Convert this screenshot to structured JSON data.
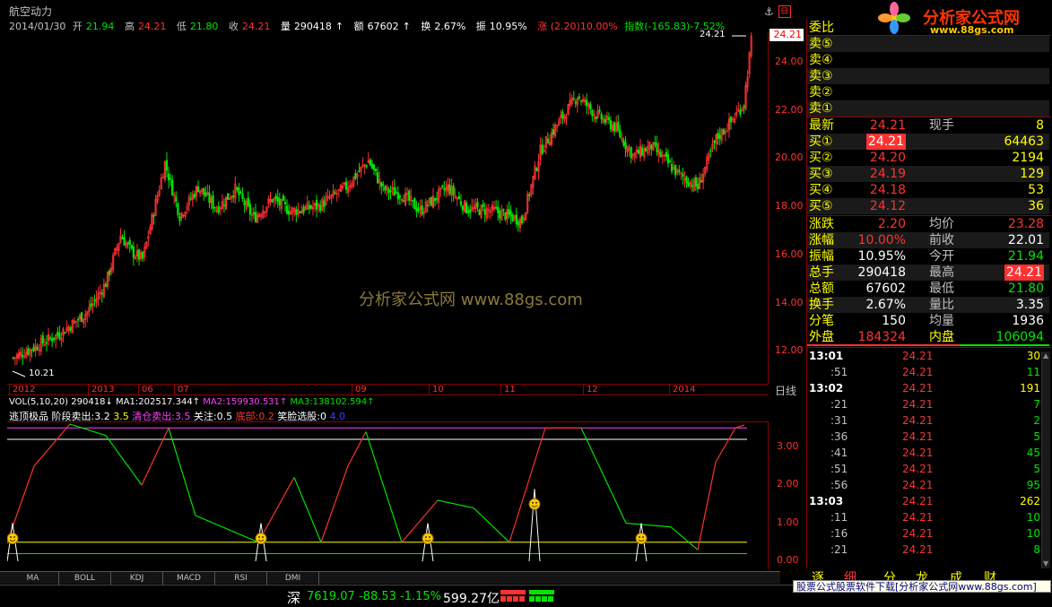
{
  "header": {
    "stock_name": "航空动力",
    "date": "2014/01/30",
    "open_label": "开",
    "open": "21.94",
    "high_label": "高",
    "high": "24.21",
    "low_label": "低",
    "low": "21.80",
    "close_label": "收",
    "close": "24.21",
    "vol_label": "量",
    "vol": "290418",
    "amt_label": "额",
    "amt": "67602",
    "turn_label": "换",
    "turn": "2.67%",
    "amp_label": "振",
    "amp": "10.95%",
    "chg": "涨 (2.20)10.00%",
    "index": "指数(-165.83)-7.52%"
  },
  "price_axis": [
    "24.00",
    "22.00",
    "20.00",
    "18.00",
    "16.00",
    "14.00",
    "12.00"
  ],
  "price_tag": "24.21",
  "max_label": "24.21",
  "min_label": "10.21",
  "watermark": "分析家公式网  www.88gs.com",
  "time_axis": [
    "2012",
    "2013",
    "06",
    "07",
    "09",
    "10",
    "11",
    "12",
    "2014"
  ],
  "period_label": "日线",
  "vol_line": {
    "label": "VOL(5,10,20)",
    "v": "290418",
    "ma1": "MA1:202517.344",
    "ma2": "MA2:159930.531",
    "ma3": "MA3:138102.594"
  },
  "ind_line": {
    "name": "逃顶极品",
    "stage_sell": "阶段卖出:3.2",
    "val35": "3.5",
    "clear_sell": "清仓卖出:3.5",
    "focus": "关注:0.5",
    "bottom": "底部:0.2",
    "laugh": "笑脸选股:0",
    "zero": "4.0"
  },
  "ind_axis": [
    "3.00",
    "2.00",
    "1.00",
    "0.00"
  ],
  "tabs": [
    "MA",
    "BOLL",
    "KDJ",
    "MACD",
    "RSI",
    "DMI"
  ],
  "right": {
    "weibi_label": "委比",
    "sells": [
      {
        "label": "卖⑤"
      },
      {
        "label": "卖④"
      },
      {
        "label": "卖③"
      },
      {
        "label": "卖②"
      },
      {
        "label": "卖①"
      }
    ],
    "latest_label": "最新",
    "latest": "24.21",
    "xianshou_label": "现手",
    "xianshou": "8",
    "buys": [
      {
        "label": "买①",
        "price": "24.21",
        "vol": "64463"
      },
      {
        "label": "买②",
        "price": "24.20",
        "vol": "2194"
      },
      {
        "label": "买③",
        "price": "24.19",
        "vol": "129"
      },
      {
        "label": "买④",
        "price": "24.18",
        "vol": "53"
      },
      {
        "label": "买⑤",
        "price": "24.12",
        "vol": "36"
      }
    ],
    "stats": [
      {
        "l1": "涨跌",
        "v1": "2.20",
        "l2": "均价",
        "v2": "23.28",
        "c1": "red",
        "c2": "red"
      },
      {
        "l1": "涨幅",
        "v1": "10.00%",
        "l2": "前收",
        "v2": "22.01",
        "c1": "red",
        "c2": "white"
      },
      {
        "l1": "振幅",
        "v1": "10.95%",
        "l2": "今开",
        "v2": "21.94",
        "c1": "white",
        "c2": "green"
      },
      {
        "l1": "总手",
        "v1": "290418",
        "l2": "最高",
        "v2": "24.21",
        "c1": "white",
        "c2": "redbox"
      },
      {
        "l1": "总额",
        "v1": "67602",
        "l2": "最低",
        "v2": "21.80",
        "c1": "white",
        "c2": "green"
      },
      {
        "l1": "换手",
        "v1": "2.67%",
        "l2": "量比",
        "v2": "3.35",
        "c1": "white",
        "c2": "white"
      },
      {
        "l1": "分笔",
        "v1": "150",
        "l2": "均量",
        "v2": "1936",
        "c1": "white",
        "c2": "white"
      }
    ],
    "outer_label": "外盘",
    "outer": "184324",
    "inner_label": "内盘",
    "inner": "106094",
    "ticks": [
      {
        "t": "13:01",
        "p": "24.21",
        "q": "30",
        "bold": true
      },
      {
        "t": ":51",
        "p": "24.21",
        "q": "11"
      },
      {
        "t": "13:02",
        "p": "24.21",
        "q": "191",
        "bold": true
      },
      {
        "t": ":21",
        "p": "24.21",
        "q": "7"
      },
      {
        "t": ":31",
        "p": "24.21",
        "q": "2"
      },
      {
        "t": ":36",
        "p": "24.21",
        "q": "5"
      },
      {
        "t": ":41",
        "p": "24.21",
        "q": "45"
      },
      {
        "t": ":51",
        "p": "24.21",
        "q": "5"
      },
      {
        "t": ":56",
        "p": "24.21",
        "q": "95"
      },
      {
        "t": "13:03",
        "p": "24.21",
        "q": "262",
        "bold": true
      },
      {
        "t": ":11",
        "p": "24.21",
        "q": "10"
      },
      {
        "t": ":16",
        "p": "24.21",
        "q": "10"
      },
      {
        "t": ":21",
        "p": "24.21",
        "q": "8"
      }
    ],
    "bottom_tabs": [
      "逐",
      "细",
      "分",
      "龙",
      "成",
      "财"
    ]
  },
  "status": {
    "market": "深",
    "index": "7619.07",
    "chg": "-88.53",
    "pct": "-1.15%",
    "amount": "599.27亿"
  },
  "logo_text": "分析家公式网",
  "logo_url": "www.88gs.com",
  "promo": "股票公式股票软件下载[分析家公式网www.88gs.com]",
  "colors": {
    "up": "#ff3232",
    "down": "#00e600",
    "bg": "#000000",
    "accent": "#ffff00"
  }
}
